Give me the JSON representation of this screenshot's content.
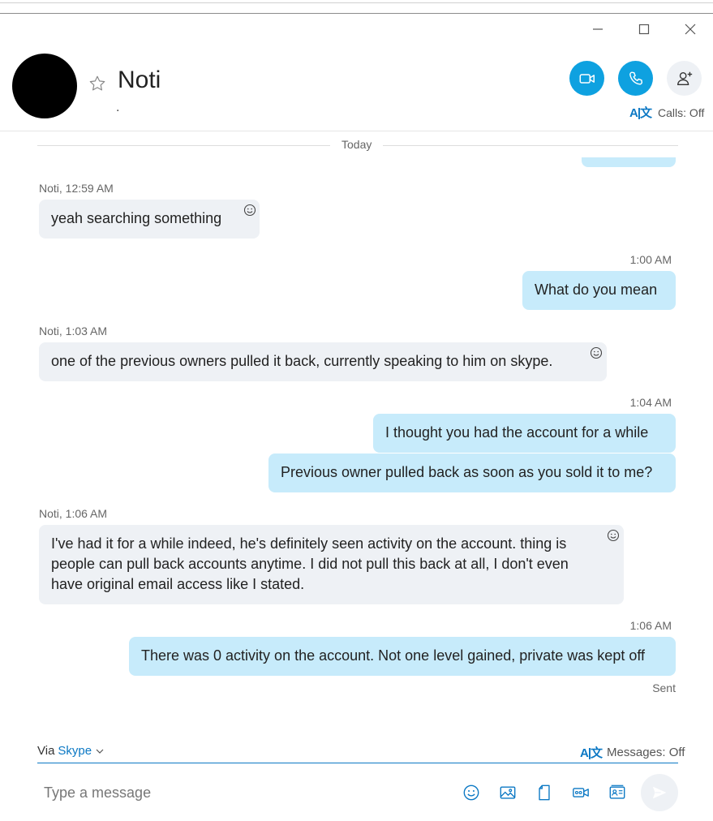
{
  "contact": {
    "name": "Noti",
    "status": "."
  },
  "header": {
    "calls_status": "Calls: Off"
  },
  "chat": {
    "date_separator": "Today",
    "messages": [
      {
        "sender": "Noti, 12:59 AM",
        "text": "yeah searching something"
      },
      {
        "time": "1:00 AM",
        "text": "What do you mean"
      },
      {
        "sender": "Noti, 1:03 AM",
        "text": "one of the previous owners pulled it back, currently speaking to him on skype."
      },
      {
        "time": "1:04 AM",
        "text": "I thought you had the account for a while"
      },
      {
        "text": "Previous owner pulled back as soon as you sold it to me?"
      },
      {
        "sender": "Noti, 1:06 AM",
        "text": "I've had it for a while indeed, he's definitely seen activity on the account. thing is people can pull back accounts anytime. I did not pull this back at all, I don't even have original email access like I stated."
      },
      {
        "time": "1:06 AM",
        "text": "There was 0 activity on the account. Not one level gained, private was kept off",
        "status": "Sent"
      }
    ]
  },
  "compose": {
    "via_label": "Via",
    "via_service": "Skype",
    "messages_status": "Messages: Off",
    "placeholder": "Type a message"
  },
  "colors": {
    "accent": "#0ea1e0",
    "link": "#0b78c4",
    "outgoing_bubble": "#c7ebfb",
    "incoming_bubble": "#eef1f5"
  },
  "icons": [
    "minimize-icon",
    "maximize-icon",
    "close-icon",
    "star-icon",
    "video-call-icon",
    "audio-call-icon",
    "add-person-icon",
    "translate-icon",
    "emoji-icon",
    "image-icon",
    "file-icon",
    "video-message-icon",
    "contact-card-icon",
    "send-icon",
    "chevron-down-icon",
    "smiley-reaction-icon"
  ]
}
